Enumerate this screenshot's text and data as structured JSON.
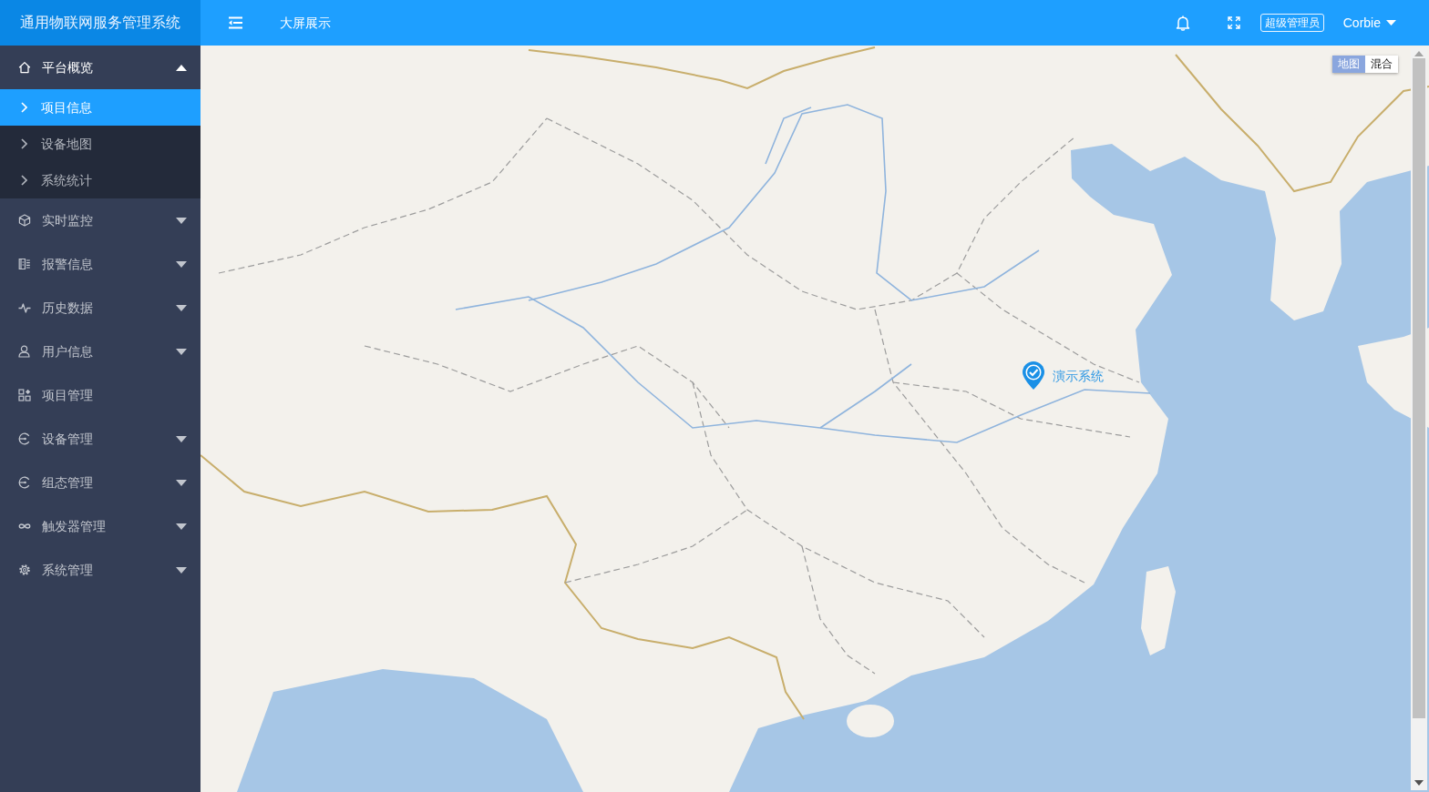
{
  "header": {
    "app_title": "通用物联网服务管理系统",
    "nav_link": "大屏展示",
    "role": "超级管理员",
    "user_name": "Corbie"
  },
  "sidebar": {
    "items": [
      {
        "label": "平台概览",
        "kind": "group",
        "expanded": true,
        "children": [
          {
            "label": "项目信息",
            "selected": true
          },
          {
            "label": "设备地图",
            "selected": false
          },
          {
            "label": "系统统计",
            "selected": false
          }
        ]
      },
      {
        "label": "实时监控",
        "kind": "group",
        "expanded": false
      },
      {
        "label": "报警信息",
        "kind": "group",
        "expanded": false
      },
      {
        "label": "历史数据",
        "kind": "group",
        "expanded": false
      },
      {
        "label": "用户信息",
        "kind": "group",
        "expanded": false
      },
      {
        "label": "项目管理",
        "kind": "link"
      },
      {
        "label": "设备管理",
        "kind": "group",
        "expanded": false
      },
      {
        "label": "组态管理",
        "kind": "group",
        "expanded": false
      },
      {
        "label": "触发器管理",
        "kind": "group",
        "expanded": false
      },
      {
        "label": "系统管理",
        "kind": "group",
        "expanded": false
      }
    ]
  },
  "map": {
    "type_toggle": [
      {
        "label": "地图",
        "selected": true
      },
      {
        "label": "混合",
        "selected": false
      }
    ],
    "marker": {
      "label": "演示系统"
    }
  }
}
